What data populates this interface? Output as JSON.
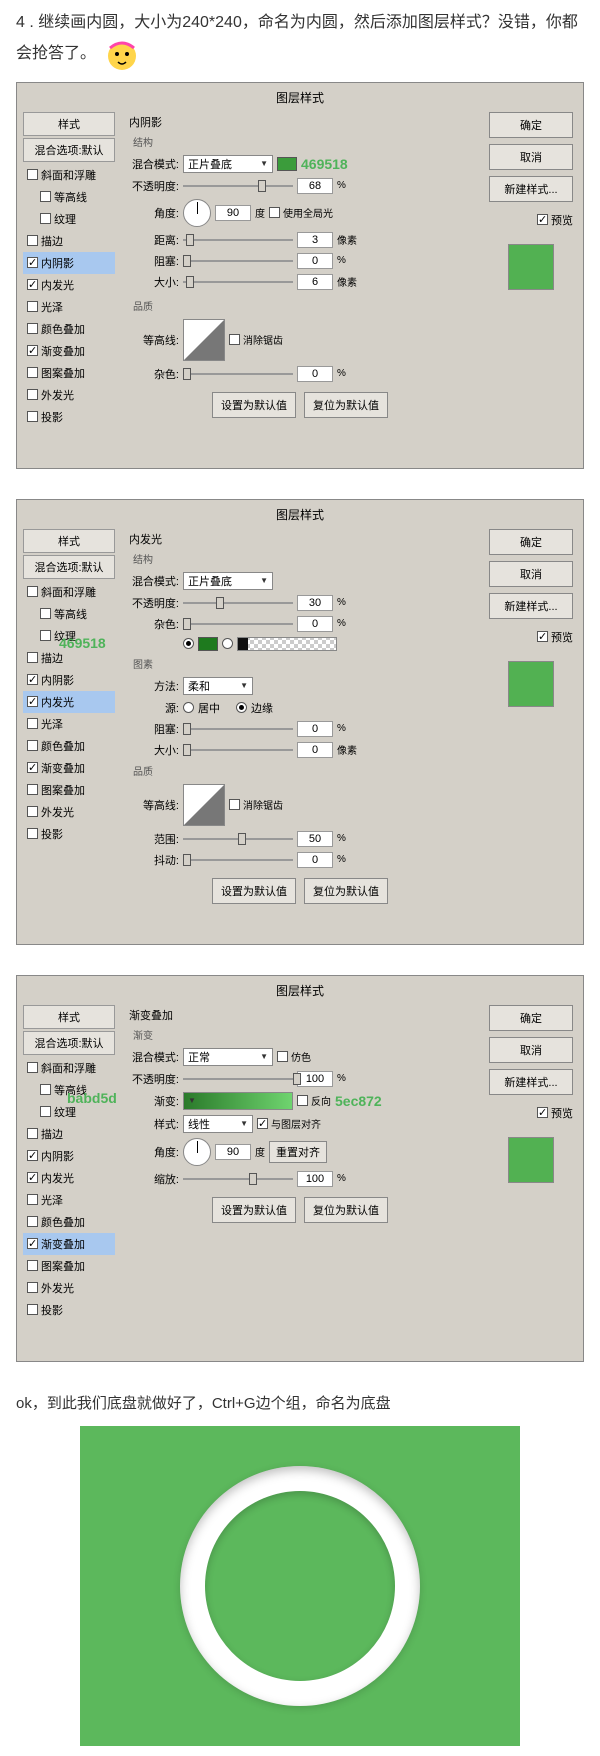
{
  "text": {
    "step": "4 . 继续画内圆，大小为240*240，命名为内圆，然后添加图层样式？没错，你都会抢答了。",
    "conclusion": "ok，到此我们底盘就做好了，Ctrl+G边个组，命名为底盘"
  },
  "common": {
    "dialog_title": "图层样式",
    "styles_header": "样式",
    "blend_header": "混合选项:默认",
    "ok": "确定",
    "cancel": "取消",
    "new_style": "新建样式...",
    "preview": "预览",
    "make_default": "设置为默认值",
    "reset_default": "复位为默认值",
    "quality": "品质",
    "contour": "等高线:",
    "anti_alias": "消除锯齿",
    "structure": "结构",
    "blend_mode": "混合模式:",
    "opacity": "不透明度:",
    "percent": "%",
    "px": "像素",
    "deg": "度"
  },
  "styles_list": [
    {
      "label": "斜面和浮雕",
      "chk": false
    },
    {
      "label": "等高线",
      "chk": false
    },
    {
      "label": "纹理",
      "chk": false
    },
    {
      "label": "描边",
      "chk": false
    },
    {
      "label": "内阴影",
      "chk": true
    },
    {
      "label": "内发光",
      "chk": true
    },
    {
      "label": "光泽",
      "chk": false
    },
    {
      "label": "颜色叠加",
      "chk": false
    },
    {
      "label": "渐变叠加",
      "chk": true
    },
    {
      "label": "图案叠加",
      "chk": false
    },
    {
      "label": "外发光",
      "chk": false
    },
    {
      "label": "投影",
      "chk": false
    }
  ],
  "d1": {
    "section": "内阴影",
    "mode": "正片叠底",
    "opacity": "68",
    "angle_lbl": "角度:",
    "angle": "90",
    "global": "使用全局光",
    "dist_lbl": "距离:",
    "dist": "3",
    "choke_lbl": "阻塞:",
    "choke": "0",
    "size_lbl": "大小:",
    "size": "6",
    "noise_lbl": "杂色:",
    "noise": "0",
    "wm": "469518",
    "swatch": "#3b9c3b",
    "preview": "#52b152"
  },
  "d2": {
    "section": "内发光",
    "mode": "正片叠底",
    "opacity": "30",
    "noise_lbl": "杂色:",
    "noise": "0",
    "elements": "图素",
    "method_lbl": "方法:",
    "method": "柔和",
    "source_lbl": "源:",
    "src_center": "居中",
    "src_edge": "边缘",
    "choke_lbl": "阻塞:",
    "choke": "0",
    "size_lbl": "大小:",
    "size": "0",
    "range_lbl": "范围:",
    "range": "50",
    "jitter_lbl": "抖动:",
    "jitter": "0",
    "wm": "469518",
    "swatch": "#1e7a1e",
    "preview": "#52b152"
  },
  "d3": {
    "section": "渐变叠加",
    "sub": "渐变",
    "mode": "正常",
    "dither": "仿色",
    "opacity": "100",
    "grad_lbl": "渐变:",
    "reverse": "反向",
    "style_lbl": "样式:",
    "style": "线性",
    "align": "与图层对齐",
    "angle_lbl": "角度:",
    "angle": "90",
    "reset_align": "重置对齐",
    "scale_lbl": "缩放:",
    "scale": "100",
    "wm1": "babd5d",
    "wm2": "5ec872",
    "preview": "#52b152"
  }
}
